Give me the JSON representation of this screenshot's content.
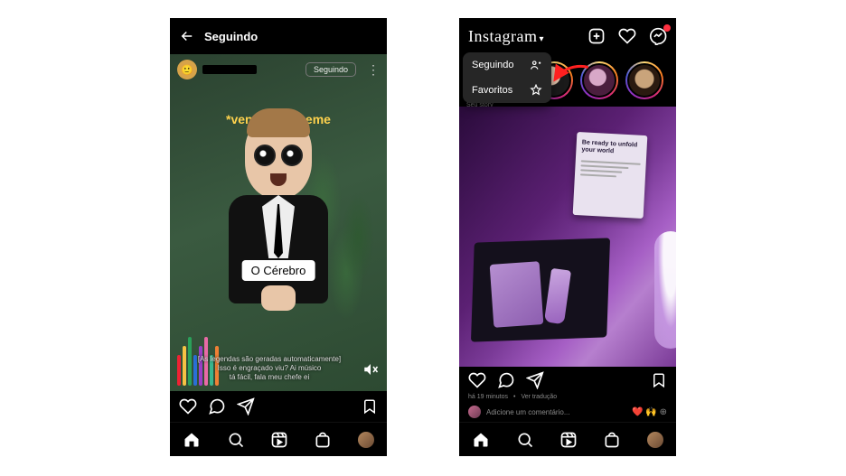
{
  "left": {
    "header": {
      "title": "Seguindo"
    },
    "post": {
      "follow_button": "Seguindo",
      "meme_overlay": "*vendo um meme",
      "caption_chip": "O Cérebro",
      "auto_sub_line1": "[As legendas são geradas automaticamente]",
      "auto_sub_line2": "Isso é engraçado viu? Ai músico",
      "auto_sub_line3": "tá fácil, fala meu chefe ei"
    },
    "pens": [
      "#e23",
      "#f6c244",
      "#2aa05a",
      "#2a6fd6",
      "#9b3fc7",
      "#e86aa6",
      "#39b68d",
      "#f08035"
    ]
  },
  "right": {
    "logo": "Instagram",
    "dropdown": {
      "following": "Seguindo",
      "favorites": "Favoritos"
    },
    "story_caption": "Seu story",
    "card_title": "Be ready to unfold your world",
    "comment_placeholder": "Adicione um comentário...",
    "meta_time": "há 19 minutos",
    "meta_sep": "•",
    "meta_translate": "Ver tradução"
  }
}
